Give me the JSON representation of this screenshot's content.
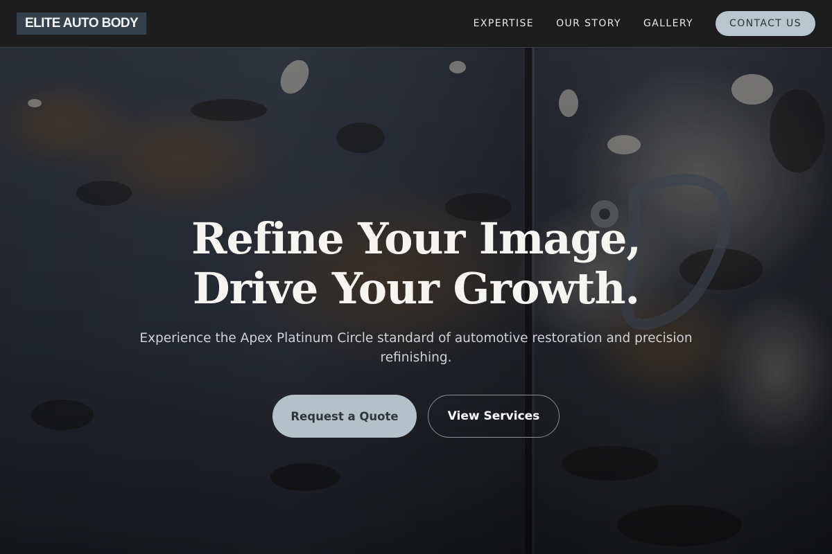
{
  "header": {
    "logo_text": "ELITE AUTO BODY",
    "nav": [
      {
        "label": "EXPERTISE"
      },
      {
        "label": "OUR STORY"
      },
      {
        "label": "GALLERY"
      }
    ],
    "contact_label": "CONTACT US"
  },
  "hero": {
    "title_line1": "Refine Your Image,",
    "title_line2": "Drive Your Growth.",
    "subtitle": "Experience the Apex Platinum Circle standard of automotive restoration and precision refinishing.",
    "primary_cta": "Request a Quote",
    "secondary_cta": "View Services"
  },
  "colors": {
    "header_bg": "#1d1d1e",
    "logo_bg": "#34404b",
    "accent": "#b8c6cf",
    "text_light": "#f7f5f2"
  }
}
